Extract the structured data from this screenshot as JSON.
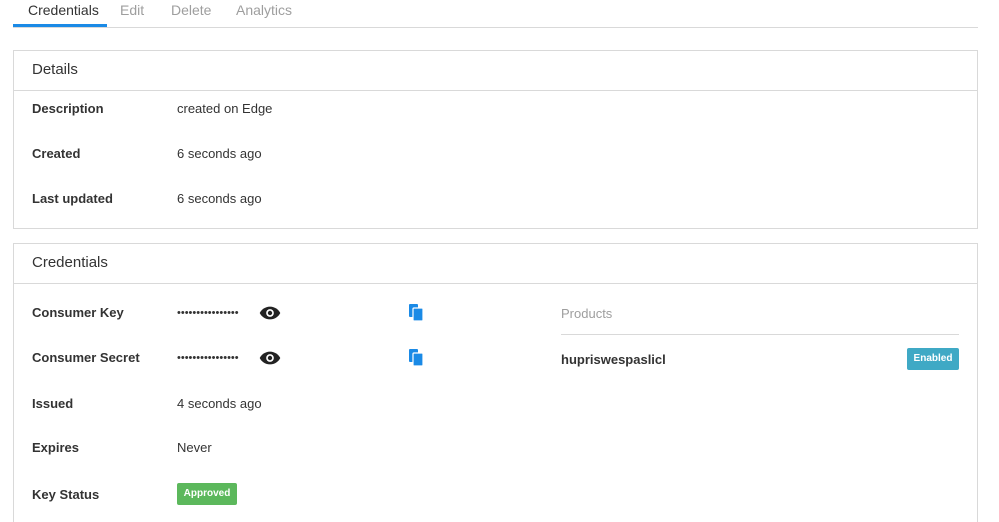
{
  "tabs": [
    {
      "label": "Credentials",
      "active": true
    },
    {
      "label": "Edit",
      "active": false
    },
    {
      "label": "Delete",
      "active": false
    },
    {
      "label": "Analytics",
      "active": false
    }
  ],
  "details": {
    "title": "Details",
    "rows": [
      {
        "label": "Description",
        "value": "created on Edge"
      },
      {
        "label": "Created",
        "value": "6 seconds ago"
      },
      {
        "label": "Last updated",
        "value": "6 seconds ago"
      }
    ]
  },
  "credentials": {
    "title": "Credentials",
    "consumer_key": {
      "label": "Consumer Key",
      "masked": "••••••••••••••••"
    },
    "consumer_secret": {
      "label": "Consumer Secret",
      "masked": "••••••••••••••••"
    },
    "issued": {
      "label": "Issued",
      "value": "4 seconds ago"
    },
    "expires": {
      "label": "Expires",
      "value": "Never"
    },
    "key_status": {
      "label": "Key Status",
      "value": "Approved"
    },
    "products": {
      "header": "Products",
      "items": [
        {
          "name": "hupriswespaslicl",
          "status": "Enabled"
        }
      ]
    }
  },
  "colors": {
    "tab_accent": "#1a8ae6",
    "copy_icon": "#1a8ae6",
    "enabled_badge": "#3fa9c5",
    "approved_badge": "#5cb85c"
  },
  "icons": {
    "reveal": "eye-icon",
    "copy": "copy-icon"
  }
}
